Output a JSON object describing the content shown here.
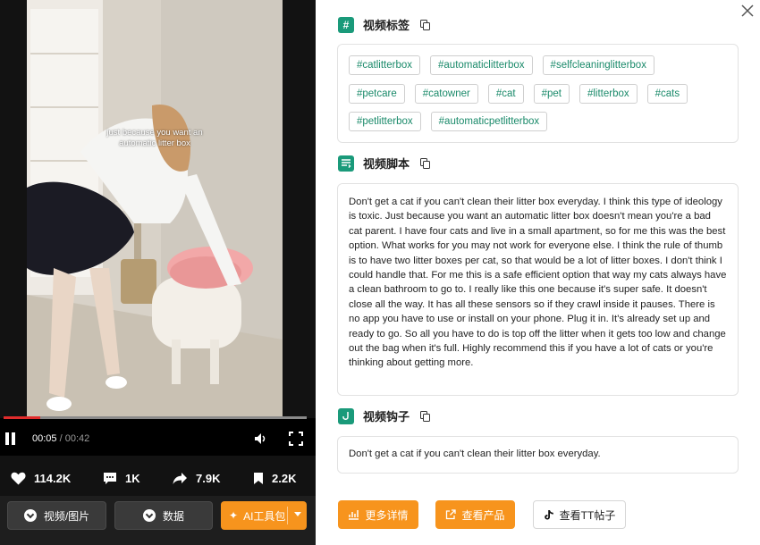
{
  "video": {
    "caption": "just because you want an automatic litter box",
    "current_time": "00:05",
    "duration": "00:42",
    "progress": 0.12,
    "progress_color": "#e02c2c"
  },
  "stats": {
    "likes": "114.2K",
    "comments": "1K",
    "shares": "7.9K",
    "saves": "2.2K"
  },
  "bottom_buttons": {
    "video_image": "视频/图片",
    "data": "数据",
    "ai_tools": "AI工具包"
  },
  "tags_section": {
    "title": "视频标签",
    "icon": "#",
    "tags": [
      "#catlitterbox",
      "#automaticlitterbox",
      "#selfcleaninglitterbox",
      "#petcare",
      "#catowner",
      "#cat",
      "#pet",
      "#litterbox",
      "#cats",
      "#petlitterbox",
      "#automaticpetlitterbox"
    ]
  },
  "script_section": {
    "title": "视频脚本",
    "text": "Don't get a cat if you can't clean their litter box everyday. I think this type of ideology is toxic. Just because you want an automatic litter box doesn't mean you're a bad cat parent. I have four cats and live in a small apartment, so for me this was the best option. What works for you may not work for everyone else. I think the rule of thumb is to have two litter boxes per cat, so that would be a lot of litter boxes. I don't think I could handle that. For me this is a safe efficient option that way my cats always have a clean bathroom to go to. I really like this one because it's super safe. It doesn't close all the way. It has all these sensors so if they crawl inside it pauses. There is no app you have to use or install on your phone. Plug it in. It's already set up and ready to go. So all you have to do is top off the litter when it gets too low and change out the bag when it's full. Highly recommend this if you have a lot of cats or you're thinking about getting more."
  },
  "hook_section": {
    "title": "视频钩子",
    "text": "Don't get a cat if you can't clean their litter box everyday."
  },
  "actions": {
    "more_details": "更多详情",
    "view_product": "查看产品",
    "view_tt_post": "查看TT帖子"
  },
  "colors": {
    "accent_green": "#1a9a7a",
    "tag_text": "#1a8a6a",
    "orange": "#f7941d"
  }
}
